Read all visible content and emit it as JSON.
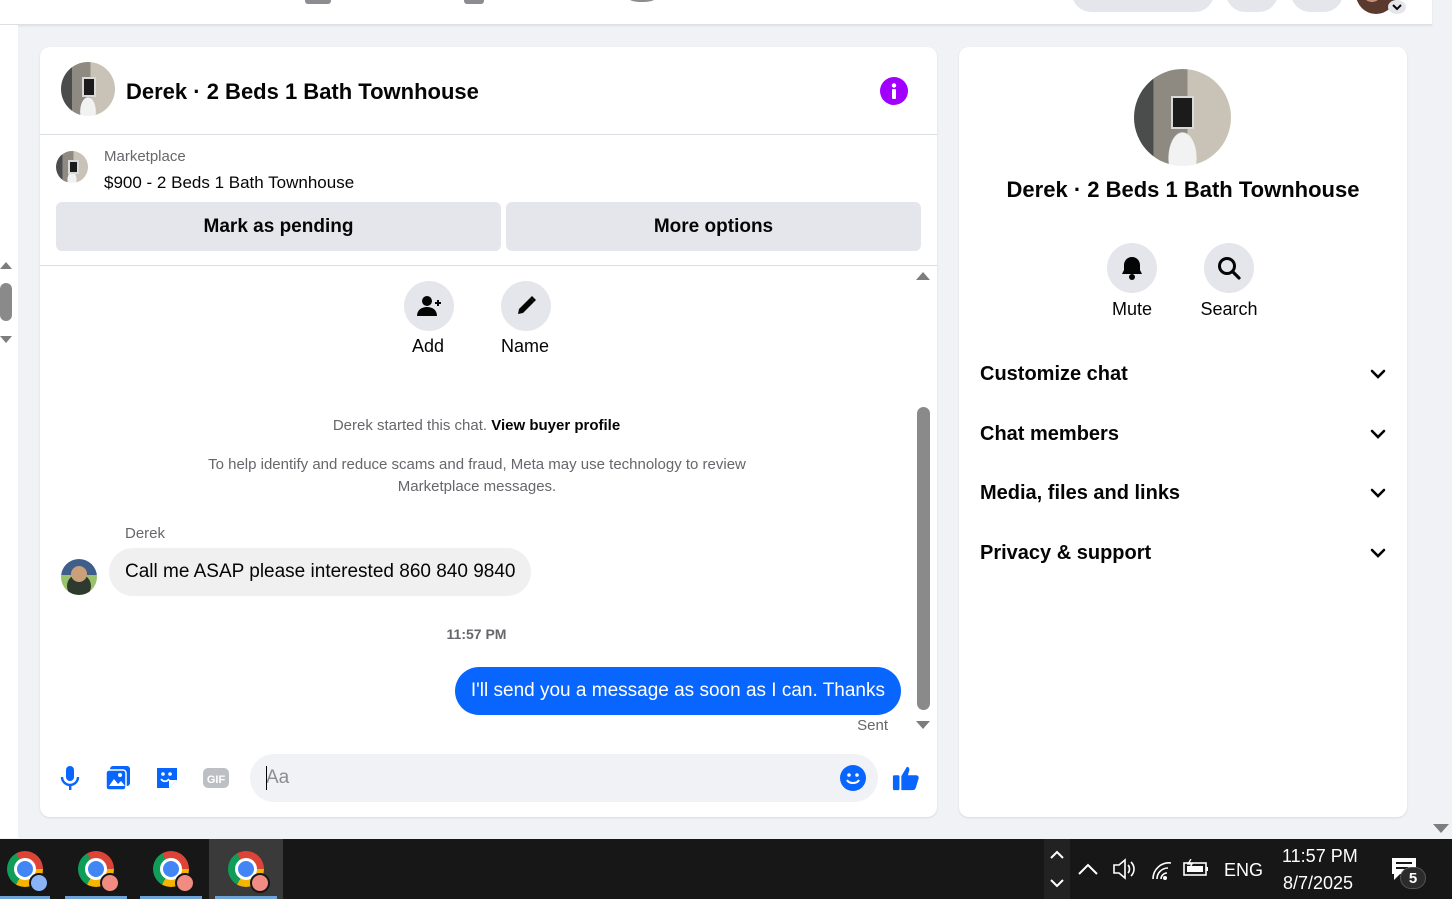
{
  "chat": {
    "title": "Derek · 2 Beds 1 Bath Townhouse",
    "listing": {
      "source": "Marketplace",
      "title": "$900 - 2 Beds 1 Bath Townhouse",
      "mark_pending_label": "Mark as pending",
      "more_options_label": "More options"
    },
    "actions": [
      {
        "label": "Add",
        "icon": "add-person-icon"
      },
      {
        "label": "Name",
        "icon": "pencil-icon"
      }
    ],
    "started_text": "Derek started this chat.",
    "view_buyer_profile": "View buyer profile",
    "scam_notice": "To help identify and reduce scams and fraud, Meta may use technology to review Marketplace messages.",
    "messages": [
      {
        "sender": "Derek",
        "text": "Call me ASAP please interested 860 840 9840",
        "direction": "incoming"
      },
      {
        "timestamp": "11:57 PM"
      },
      {
        "text": "I'll send you a message as soon as I can. Thanks",
        "direction": "outgoing",
        "status": "Sent"
      }
    ],
    "composer": {
      "placeholder": "Aa",
      "icons": [
        "microphone-icon",
        "photo-icon",
        "sticker-icon",
        "gif-icon",
        "emoji-icon",
        "thumbs-up-icon"
      ]
    }
  },
  "info_panel": {
    "title": "Derek · 2 Beds 1 Bath Townhouse",
    "actions": [
      {
        "label": "Mute",
        "icon": "bell-icon"
      },
      {
        "label": "Search",
        "icon": "search-icon"
      }
    ],
    "sections": [
      "Customize chat",
      "Chat members",
      "Media, files and links",
      "Privacy & support"
    ]
  },
  "taskbar": {
    "language": "ENG",
    "time": "11:57 PM",
    "date": "8/7/2025",
    "notification_count": "5"
  },
  "colors": {
    "accent_blue": "#0866ff",
    "info_purple": "#a100ff",
    "bubble_gray": "#f0f0f0",
    "taskbar": "#171717"
  }
}
